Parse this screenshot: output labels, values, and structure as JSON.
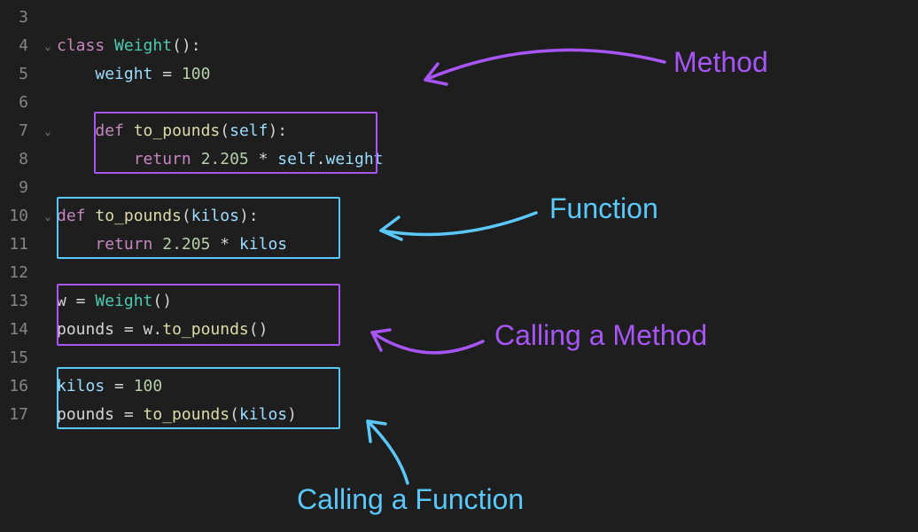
{
  "lineStart": 3,
  "lineEnd": 17,
  "foldLines": [
    4,
    7,
    10
  ],
  "code": {
    "l3": "",
    "l4_class": "class",
    "l4_name": "Weight",
    "l4_paren": "():",
    "l5_var": "weight",
    "l5_eq": " = ",
    "l5_val": "100",
    "l7_def": "def",
    "l7_fn": "to_pounds",
    "l7_args_open": "(",
    "l7_self": "self",
    "l7_args_close": "):",
    "l8_ret": "return",
    "l8_num": "2.205",
    "l8_op": " * ",
    "l8_self": "self",
    "l8_dot": ".",
    "l8_prop": "weight",
    "l10_def": "def",
    "l10_fn": "to_pounds",
    "l10_open": "(",
    "l10_param": "kilos",
    "l10_close": "):",
    "l11_ret": "return",
    "l11_num": "2.205",
    "l11_op": " * ",
    "l11_var": "kilos",
    "l13_var": "w",
    "l13_eq": " = ",
    "l13_cls": "Weight",
    "l13_paren": "()",
    "l14_var": "pounds",
    "l14_eq": " = ",
    "l14_obj": "w",
    "l14_dot": ".",
    "l14_fn": "to_pounds",
    "l14_paren": "()",
    "l16_var": "kilos",
    "l16_eq": " = ",
    "l16_val": "100",
    "l17_var": "pounds",
    "l17_eq": " = ",
    "l17_fn": "to_pounds",
    "l17_open": "(",
    "l17_arg": "kilos",
    "l17_close": ")"
  },
  "labels": {
    "method": "Method",
    "function": "Function",
    "callMethod": "Calling a Method",
    "callFunction": "Calling a Function"
  },
  "colors": {
    "purple": "#a855f7",
    "blue": "#5ac8fa"
  }
}
